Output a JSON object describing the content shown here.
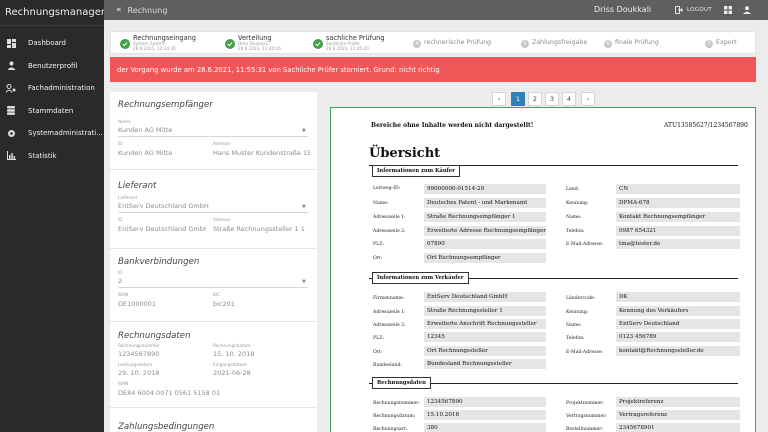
{
  "app": {
    "title": "Rechnungsmanager",
    "breadcrumb": "Rechnung"
  },
  "nav": [
    {
      "label": "Dashboard",
      "icon": "dashboard-icon"
    },
    {
      "label": "Benutzerprofil",
      "icon": "person-icon"
    },
    {
      "label": "Fachadministration",
      "icon": "people-settings-icon"
    },
    {
      "label": "Stammdaten",
      "icon": "database-icon"
    },
    {
      "label": "Systemadministrati...",
      "icon": "gear-shield-icon"
    },
    {
      "label": "Statistik",
      "icon": "bar-chart-icon"
    }
  ],
  "topbar": {
    "user": "Driss Doukkali",
    "logout": "LOGOUT"
  },
  "steps": [
    {
      "label": "Rechnungseingang",
      "sub1": "System System",
      "sub2": "28.6.2021, 11:34:30",
      "done": true
    },
    {
      "label": "Verteilung",
      "sub1": "Driss Doukkali",
      "sub2": "28.6.2021, 11:44:16",
      "done": true
    },
    {
      "label": "sachliche Prüfung",
      "sub1": "Sachliche Prüfer",
      "sub2": "28.6.2021, 11:45:20",
      "done": true
    },
    {
      "label": "rechnerische Prüfung",
      "num": "4",
      "done": false
    },
    {
      "label": "Zahlungsfreigabe",
      "num": "5",
      "done": false
    },
    {
      "label": "finale Prüfung",
      "num": "6",
      "done": false
    },
    {
      "label": "Export",
      "num": "7",
      "done": false
    }
  ],
  "alert": "der Vorgang wurde am 28.6.2021, 11:55:31 von Sachliche Prüfer storniert. Grund: nicht richtig",
  "pager": {
    "prev": "‹",
    "pages": [
      "1",
      "2",
      "3",
      "4"
    ],
    "next": "›",
    "active": "1"
  },
  "form": {
    "recipient": {
      "title": "Rechnungsempfänger",
      "name_label": "Name",
      "name": "Kunden AG Mitte",
      "id_label": "ID",
      "id": "Kunden AG Mitte",
      "addr_label": "Adresse",
      "addr": "Hans Muster Kundenstraße 15"
    },
    "supplier": {
      "title": "Lieferant",
      "name_label": "Lieferant",
      "name": "EntServ Deutschland GmbH",
      "id_label": "ID",
      "id": "EntServ Deutschland GmbH",
      "addr_label": "Adresse",
      "addr": "Straße Rechnungssteller 1   1"
    },
    "bank": {
      "title": "Bankverbindungen",
      "id_label": "ID",
      "id": "2",
      "iban_label": "IBAN",
      "iban": "DE1000001",
      "bic_label": "BIC",
      "bic": "bic201"
    },
    "invoice": {
      "title": "Rechnungsdaten",
      "num_label": "Rechnungsnummer",
      "num": "1234567890",
      "date_label": "Rechnungsdatum",
      "date": "15. 10. 2018",
      "ldate_label": "Leistungsdatum",
      "ldate": "29. 10. 2018",
      "edate_label": "Eingangsdatum",
      "edate": "2021-06-28",
      "iban_label": "IBAN",
      "iban": "DE84 6004 0071 0561 5158 01"
    },
    "payment": {
      "title": "Zahlungsbedingungen"
    }
  },
  "doc": {
    "note": "Bereiche ohne Inhalte werden nicht dargestellt!",
    "ref": "ATU13585627/1234567890",
    "title": "Übersicht",
    "buyer_title": "Informationen zum Käufer",
    "buyer_left": [
      {
        "l": "Leitweg-ID:",
        "v": "99000000-01514-29"
      },
      {
        "l": "Name:",
        "v": "Deutsches Patent - und Markenamt"
      },
      {
        "l": "Adresszeile 1:",
        "v": "Straße Rechnungsempfänger 1"
      },
      {
        "l": "Adresszeile 2:",
        "v": "Erweiterte Adresse Rechnungsempfänger"
      },
      {
        "l": "PLZ:",
        "v": "67890"
      },
      {
        "l": "Ort:",
        "v": "Ort Rechnungsempfänger"
      }
    ],
    "buyer_right": [
      {
        "l": "Land:",
        "v": "CN"
      },
      {
        "l": "Kennung:",
        "v": "DPMA-678"
      },
      {
        "l": "Name:",
        "v": "Kontakt Rechnungsempfänger"
      },
      {
        "l": "Telefon:",
        "v": "0987 654321"
      },
      {
        "l": "E-Mail-Adresse:",
        "v": "tina@tester.de"
      }
    ],
    "seller_title": "Informationen zum Verkäufer",
    "seller_left": [
      {
        "l": "Firmenname:",
        "v": "EntServ Deutschland GmbH"
      },
      {
        "l": "Adresszeile 1:",
        "v": "Straße Rechnungssteller 1"
      },
      {
        "l": "Adresszeile 2:",
        "v": "Erweiterte Anschrift Rechnungssteller"
      },
      {
        "l": "PLZ:",
        "v": "12345"
      },
      {
        "l": "Ort:",
        "v": "Ort Rechnungssteller"
      },
      {
        "l": "Bundesland:",
        "v": "Bundesland Rechnungssteller"
      }
    ],
    "seller_right": [
      {
        "l": "Ländercode:",
        "v": "DK"
      },
      {
        "l": "Kennung:",
        "v": "Kennung des Verkäufers"
      },
      {
        "l": "Name:",
        "v": "EntServ Deutschland"
      },
      {
        "l": "Telefon:",
        "v": "0123 456789"
      },
      {
        "l": "E-Mail-Adresse:",
        "v": "kontakt@Rechnungssteller.de"
      }
    ],
    "inv_title": "Rechnungsdaten",
    "inv_left": [
      {
        "l": "Rechnungsnummer:",
        "v": "1234567890"
      },
      {
        "l": "Rechnungsdatum:",
        "v": "15.10.2018"
      },
      {
        "l": "Rechnungsart:",
        "v": "380"
      }
    ],
    "inv_right": [
      {
        "l": "Projektnummer:",
        "v": "Projektreferenz"
      },
      {
        "l": "Vertragsnummer:",
        "v": "Vertragsreferenz"
      },
      {
        "l": "Bestellnummer:",
        "v": "2345678901"
      }
    ]
  }
}
